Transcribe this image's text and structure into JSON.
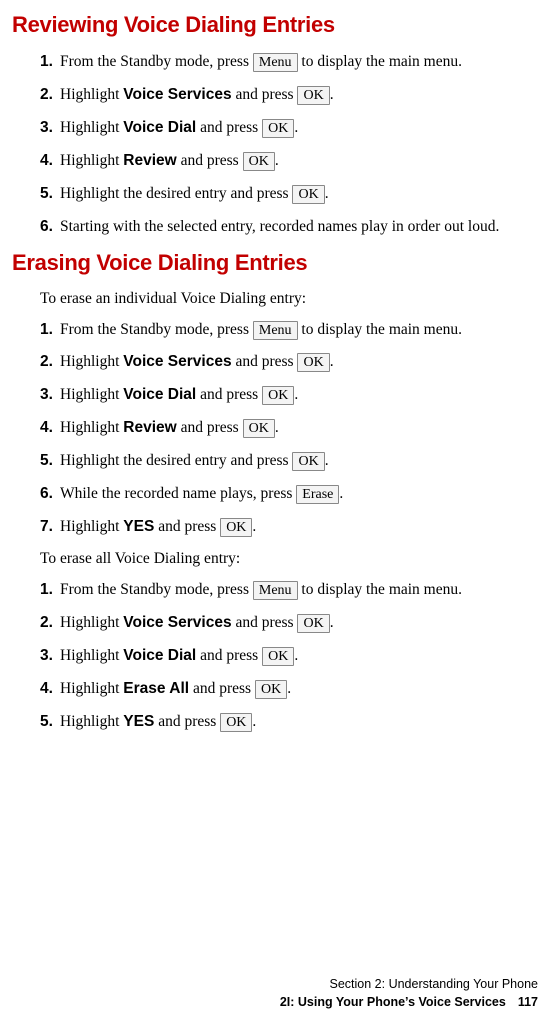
{
  "headings": {
    "h1": "Reviewing Voice Dialing Entries",
    "h2": "Erasing Voice Dialing Entries"
  },
  "keys": {
    "menu": "Menu",
    "ok": "OK",
    "erase": "Erase"
  },
  "bold": {
    "voice_services": "Voice Services",
    "voice_dial": "Voice Dial",
    "review": "Review",
    "erase_all": "Erase All",
    "yes": "YES"
  },
  "review_steps": {
    "s1a": "From the Standby mode, press ",
    "s1b": " to display the main menu.",
    "s2a": "Highlight ",
    "s2b": " and press ",
    "s2c": ".",
    "s3a": "Highlight ",
    "s3b": " and press ",
    "s3c": ".",
    "s4a": "Highlight ",
    "s4b": " and press ",
    "s4c": ".",
    "s5a": "Highlight the desired entry and press ",
    "s5b": ".",
    "s6": "Starting with the selected entry, recorded names play in order out loud."
  },
  "erase_intro1": "To erase an individual Voice Dialing entry:",
  "erase_one_steps": {
    "s1a": "From the Standby mode, press ",
    "s1b": " to display the main menu.",
    "s2a": "Highlight ",
    "s2b": " and press ",
    "s2c": ".",
    "s3a": "Highlight ",
    "s3b": " and press ",
    "s3c": ".",
    "s4a": "Highlight ",
    "s4b": " and press ",
    "s4c": ".",
    "s5a": "Highlight the desired entry and press ",
    "s5b": ".",
    "s6a": "While the recorded name plays, press ",
    "s6b": ".",
    "s7a": "Highlight ",
    "s7b": " and press ",
    "s7c": "."
  },
  "erase_intro2": "To erase all Voice Dialing entry:",
  "erase_all_steps": {
    "s1a": "From the Standby mode, press ",
    "s1b": " to display the main menu.",
    "s2a": "Highlight ",
    "s2b": " and press ",
    "s2c": ".",
    "s3a": "Highlight ",
    "s3b": " and press ",
    "s3c": ".",
    "s4a": "Highlight ",
    "s4b": " and press ",
    "s4c": ".",
    "s5a": "Highlight ",
    "s5b": " and press ",
    "s5c": "."
  },
  "nums": {
    "n1": "1.",
    "n2": "2.",
    "n3": "3.",
    "n4": "4.",
    "n5": "5.",
    "n6": "6.",
    "n7": "7."
  },
  "footer": {
    "line1": "Section 2: Understanding Your Phone",
    "line2": "2I: Using Your Phone’s Voice Services",
    "pagenum": "117"
  }
}
